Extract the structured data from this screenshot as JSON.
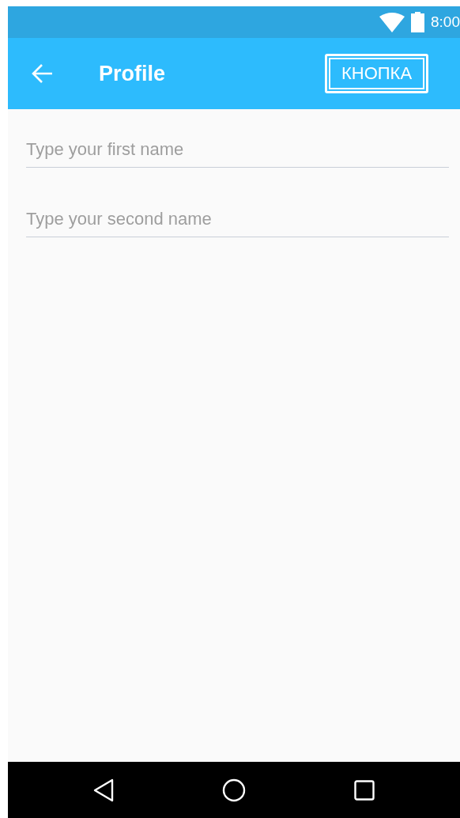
{
  "status_bar": {
    "time": "8:00"
  },
  "app_bar": {
    "title": "Profile",
    "action": "КНОПКА"
  },
  "fields": [
    {
      "placeholder": "Type your first name"
    },
    {
      "placeholder": "Type your second name"
    }
  ]
}
